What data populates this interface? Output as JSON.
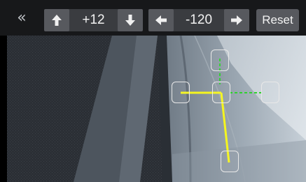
{
  "toolbar": {
    "collapse_glyph": "«",
    "vertical_offset": "+12",
    "horizontal_offset": "-120",
    "reset_label": "Reset",
    "icons": {
      "collapse": "double-chevron-left-icon",
      "up": "arrow-up-icon",
      "down": "arrow-down-icon",
      "left": "arrow-left-icon",
      "right": "arrow-right-icon"
    }
  },
  "colors": {
    "toolbar_bg": "#17181a",
    "button_bg": "#57595e",
    "guide_solid": "#f5f51e",
    "guide_dashed": "#2fd12f",
    "handle_border": "#e8e8e8"
  }
}
